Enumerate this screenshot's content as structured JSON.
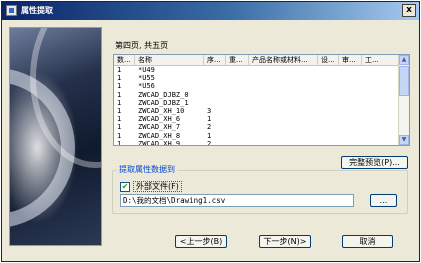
{
  "window": {
    "title": "属性提取",
    "close_label": "x"
  },
  "page_indicator": "第四页, 共五页",
  "table": {
    "columns": [
      "数...",
      "名称",
      "序...",
      "重...",
      "产品名称或材料...",
      "设...",
      "审...",
      "工..."
    ],
    "rows": [
      [
        "1",
        "*U49",
        "",
        "",
        "",
        "",
        "",
        ""
      ],
      [
        "1",
        "*U55",
        "",
        "",
        "",
        "",
        "",
        ""
      ],
      [
        "1",
        "*U56",
        "",
        "",
        "",
        "",
        "",
        ""
      ],
      [
        "1",
        "ZWCAD_DJBZ_0",
        "",
        "",
        "",
        "",
        "",
        ""
      ],
      [
        "1",
        "ZWCAD_DJBZ_1",
        "",
        "",
        "",
        "",
        "",
        ""
      ],
      [
        "1",
        "ZWCAD_XH_10",
        "3",
        "",
        "",
        "",
        "",
        ""
      ],
      [
        "1",
        "ZWCAD_XH_6",
        "1",
        "",
        "",
        "",
        "",
        ""
      ],
      [
        "1",
        "ZWCAD_XH_7",
        "2",
        "",
        "",
        "",
        "",
        ""
      ],
      [
        "1",
        "ZWCAD_XH_8",
        "1",
        "",
        "",
        "",
        "",
        ""
      ],
      [
        "1",
        "ZWCAD_XH_9",
        "2",
        "",
        "",
        "",
        "",
        ""
      ]
    ]
  },
  "buttons": {
    "full_preview": "完整预览(P)...",
    "back": "<上一步(B)",
    "next": "下一步(N)>",
    "cancel": "取消",
    "browse": "..."
  },
  "extract_group": {
    "title": "提取属性数据到",
    "external_file_label": "外部文件(F)",
    "external_file_checked": true,
    "path": "D:\\我的文档\\Drawing1.csv"
  }
}
